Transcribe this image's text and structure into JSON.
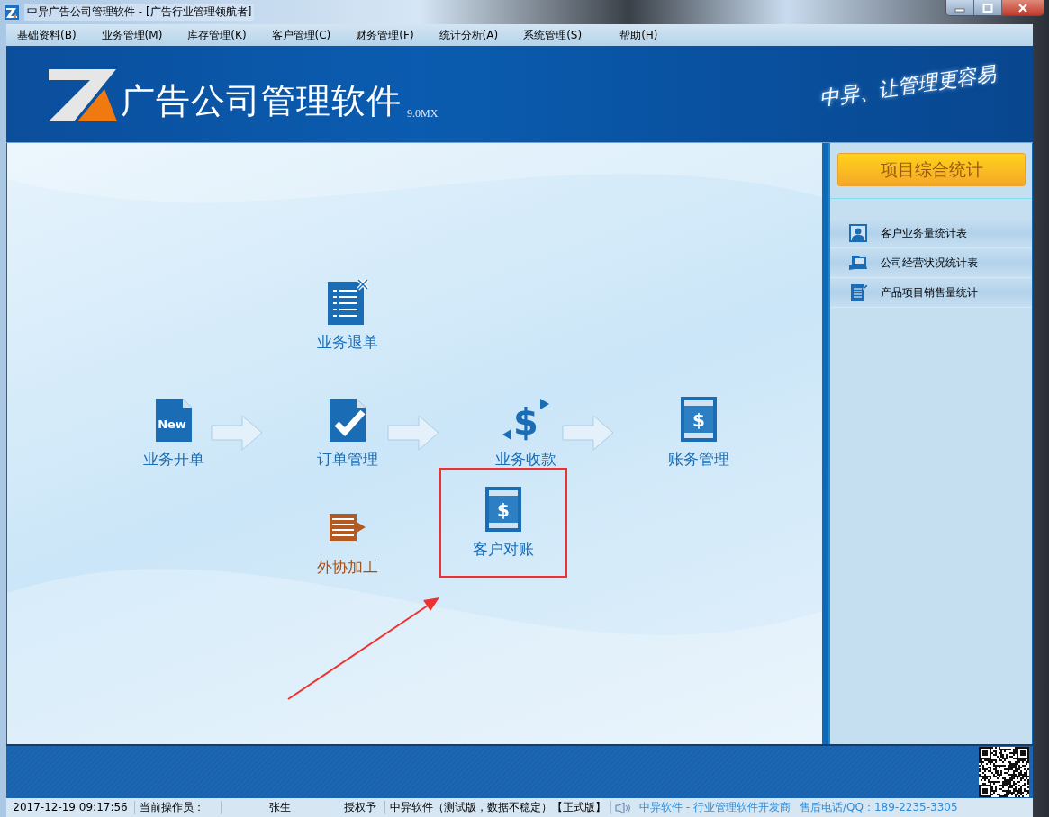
{
  "window": {
    "title": "中异广告公司管理软件 - [广告行业管理领航者]"
  },
  "menu": [
    "基础资料(B)",
    "业务管理(M)",
    "库存管理(K)",
    "客户管理(C)",
    "财务管理(F)",
    "统计分析(A)",
    "系统管理(S)",
    "帮助(H)"
  ],
  "banner": {
    "title": "广告公司管理软件",
    "version": "9.0MX",
    "slogan": "中异、让管理更容易"
  },
  "flow": {
    "nodes": [
      {
        "kind": "cancel",
        "label": "业务退单",
        "color": "#1a6db5"
      },
      {
        "kind": "new",
        "label": "业务开单",
        "icon_text": "New",
        "color": "#1a6db5"
      },
      {
        "kind": "check",
        "label": "订单管理",
        "color": "#1a6db5"
      },
      {
        "kind": "dollar",
        "label": "业务收款",
        "icon_text": "$",
        "color": "#1a6db5"
      },
      {
        "kind": "ledger",
        "label": "账务管理",
        "icon_text": "$",
        "color": "#1a6db5"
      },
      {
        "kind": "outsource",
        "label": "外协加工",
        "color": "#a0521e"
      },
      {
        "kind": "ledger",
        "label": "客户对账",
        "icon_text": "$",
        "color": "#1a6db5",
        "highlighted": true
      }
    ]
  },
  "side_panel": {
    "header": "项目综合统计",
    "items": [
      {
        "kind": "person",
        "label": "客户业务量统计表"
      },
      {
        "kind": "folder",
        "label": "公司经营状况统计表"
      },
      {
        "kind": "notepad",
        "label": "产品项目销售量统计"
      }
    ]
  },
  "status_bar": {
    "datetime": "2017-12-19 09:17:56",
    "operator_label": "当前操作员：",
    "operator": "张生",
    "license_label": "授权予",
    "licensee": "中异软件（测试版，数据不稳定）【正式版】",
    "vendor": "中异软件 - 行业管理软件开发商",
    "support": "售后电话/QQ：189-2235-3305"
  }
}
